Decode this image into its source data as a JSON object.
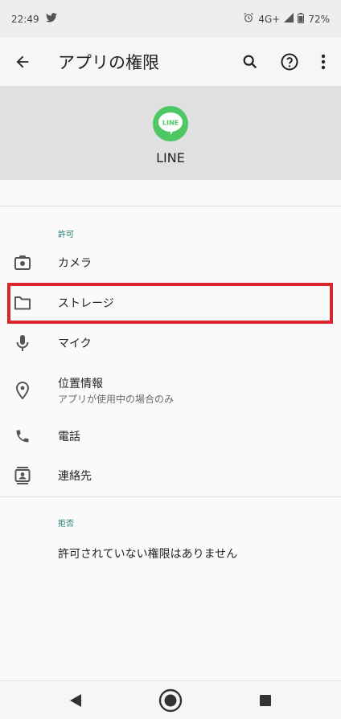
{
  "status_bar": {
    "time": "22:49",
    "network": "4G+",
    "battery": "72%",
    "icons": [
      "twitter-icon",
      "alarm-icon",
      "signal-icon",
      "battery-icon"
    ]
  },
  "app_bar": {
    "title": "アプリの権限",
    "actions": [
      "back-arrow-icon",
      "search-icon",
      "help-icon",
      "more-vert-icon"
    ]
  },
  "app": {
    "name": "LINE",
    "logo_text": "LINE",
    "brand_color": "#4cc764"
  },
  "allowed": {
    "label": "許可",
    "items": [
      {
        "label": "カメラ",
        "icon": "camera-icon"
      },
      {
        "label": "ストレージ",
        "icon": "folder-icon",
        "highlighted": true
      },
      {
        "label": "マイク",
        "icon": "mic-icon"
      },
      {
        "label": "位置情報",
        "sublabel": "アプリが使用中の場合のみ",
        "icon": "location-icon"
      },
      {
        "label": "電話",
        "icon": "phone-icon"
      },
      {
        "label": "連絡先",
        "icon": "contacts-icon"
      }
    ]
  },
  "denied": {
    "label": "拒否",
    "empty_text": "許可されていない権限はありません"
  },
  "nav": [
    "back-triangle-icon",
    "home-circle-icon",
    "recents-square-icon"
  ],
  "colors": {
    "accent": "#1e7d6d",
    "highlight": "#d8262c"
  }
}
